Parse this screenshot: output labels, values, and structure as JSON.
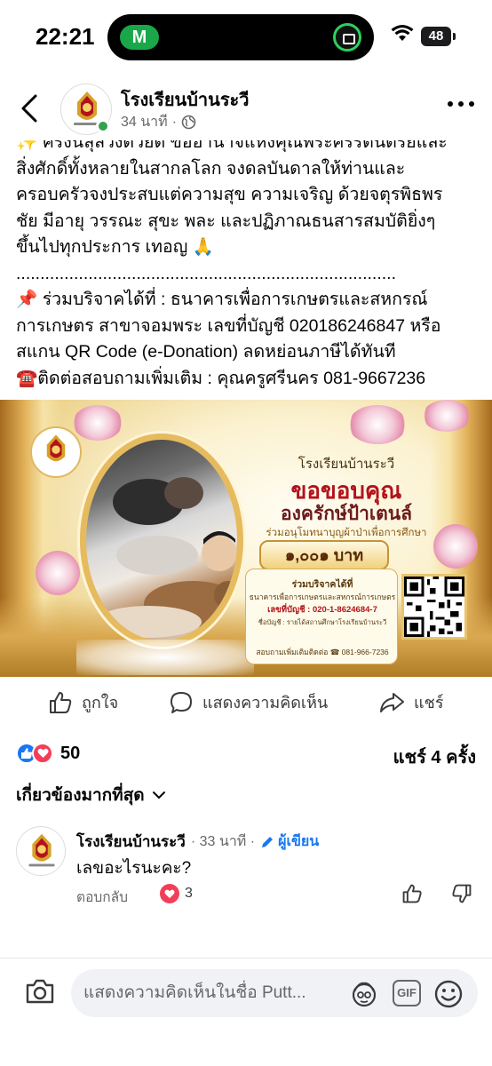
{
  "status_bar": {
    "time": "22:21",
    "island_app_letter": "M",
    "battery": "48"
  },
  "header": {
    "page_name": "โรงเรียนบ้านระวี",
    "time_ago": "34 นาที",
    "separator": "·"
  },
  "post": {
    "clipped_top_line": "✨ ครั้งนี้ลุล่วงด้วยดี ขออำนาจแห่งคุณพระศรีรัตนตรัยและ",
    "lines": [
      "สิ่งศักดิ์ทั้งหลายในสากลโลก  จงดลบันดาลให้ท่านและ",
      "ครอบครัวจงประสบแต่ความสุข  ความเจริญ  ด้วยจตุรพิธพร",
      "ชัย มีอายุ  วรรณะ  สุขะ  พละ  และปฏิภาณธนสารสมบัติยิ่งๆ",
      "ขึ้นไปทุกประการ เทอญ 🙏"
    ],
    "divider": "...............................................................................",
    "donate_line_1": "📌 ร่วมบริจาคได้ที่ : ธนาคารเพื่อการเกษตรและสหกรณ์",
    "donate_line_2": "การเกษตร  สาขาจอมพระ เลขที่บัญชี 020186246847 หรือ",
    "donate_line_3": "สแกน QR Code (e-Donation) ลดหย่อนภาษีได้ทันที",
    "contact_line": "☎️ติดต่อสอบถามเพิ่มเติม : คุณครูศรีนคร 081-9667236"
  },
  "banner": {
    "school": "โรงเรียนบ้านระวี",
    "thanks": "ขอขอบคุณ",
    "org": "องครักษ์ป้าเตนล์",
    "purpose": "ร่วมอนุโมทนาบุญผ้าป่าเพื่อการศึกษา",
    "amount": "๑,๐๐๑ บาท",
    "box_title": "ร่วมบริจาคได้ที่",
    "box_bank": "ธนาคารเพื่อการเกษตรและสหกรณ์การเกษตร",
    "box_account": "เลขที่บัญชี : 020-1-8624684-7",
    "box_account_name": "ชื่อบัญชี : รายได้สถานศึกษาโรงเรียนบ้านระวี",
    "box_contact": "สอบถามเพิ่มเติมติดต่อ  ☎ 081-966-7236"
  },
  "actions": {
    "like": "ถูกใจ",
    "comment": "แสดงความคิดเห็น",
    "share": "แชร์"
  },
  "stats": {
    "reactions_count": "50",
    "shares": "แชร์ 4 ครั้ง"
  },
  "sort": {
    "label": "เกี่ยวข้องมากที่สุด"
  },
  "comment": {
    "author": "โรงเรียนบ้านระวี",
    "time": "· 33 นาที ·",
    "author_badge": "ผู้เขียน",
    "text": "เลขอะไรนะคะ?",
    "reply": "ตอบกลับ",
    "reaction_count": "3"
  },
  "composer": {
    "placeholder": "แสดงความคิดเห็นในชื่อ Putt...",
    "gif_label": "GIF"
  },
  "colors": {
    "accent": "#1877f2",
    "love": "#f33e58",
    "online": "#31a24c",
    "thanks_red": "#b3121b"
  }
}
